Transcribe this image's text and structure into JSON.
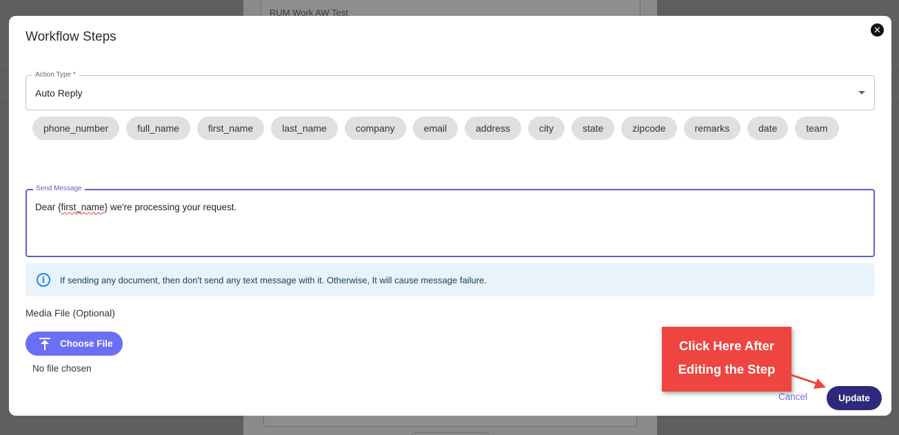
{
  "background": {
    "input_value": "RUM Work AW Test"
  },
  "modal": {
    "title": "Workflow Steps",
    "close_icon": "close-icon"
  },
  "action_type": {
    "label": "Action Type *",
    "value": "Auto Reply"
  },
  "variables": [
    "phone_number",
    "full_name",
    "first_name",
    "last_name",
    "company",
    "email",
    "address",
    "city",
    "state",
    "zipcode",
    "remarks",
    "date",
    "team"
  ],
  "send_message": {
    "label": "Send Message",
    "prefix": "Dear {",
    "variable": "first_name",
    "suffix": "} we're processing your request."
  },
  "info_alert": {
    "icon": "info-icon",
    "text": "If sending any document, then don't send any text message with it. Otherwise, It will cause message failure."
  },
  "media": {
    "label": "Media File (Optional)",
    "button_label": "Choose File",
    "button_icon": "upload-icon",
    "status": "No file chosen"
  },
  "actions": {
    "cancel_label": "Cancel",
    "update_label": "Update"
  },
  "annotation": {
    "line1": "Click Here After",
    "line2": "Editing the Step",
    "color": "#ee4540"
  },
  "colors": {
    "primary": "#6a6ff5",
    "update": "#2d2a7c",
    "focus": "#5b5fc7",
    "info": "#1e88e5"
  }
}
